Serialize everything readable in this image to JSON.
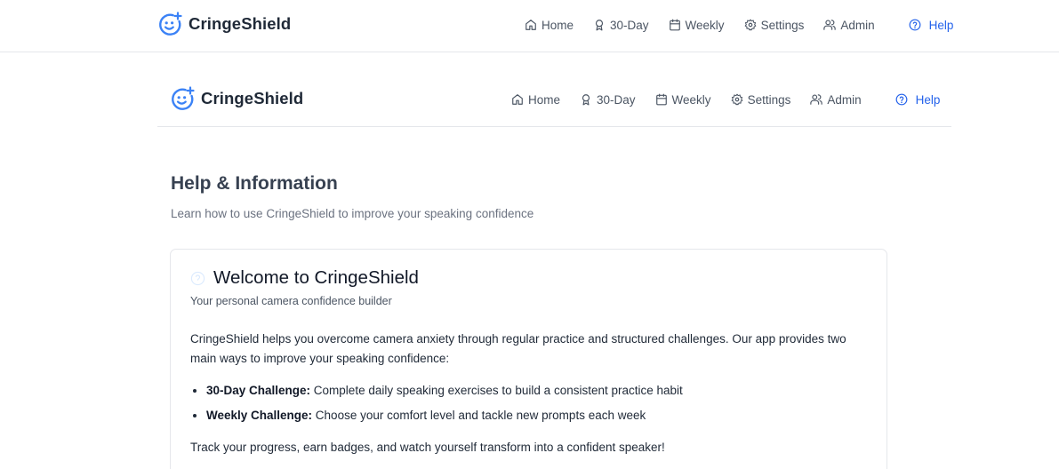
{
  "app": {
    "name": "CringeShield",
    "brand_color": "#3b82f6"
  },
  "nav": {
    "items": [
      {
        "label": "Home",
        "icon": "home-icon"
      },
      {
        "label": "30-Day",
        "icon": "award-icon"
      },
      {
        "label": "Weekly",
        "icon": "calendar-icon"
      },
      {
        "label": "Settings",
        "icon": "gear-icon"
      },
      {
        "label": "Admin",
        "icon": "users-icon"
      }
    ],
    "help": {
      "label": "Help",
      "icon": "help-circle-icon",
      "color": "#2563eb"
    }
  },
  "page": {
    "title": "Help & Information",
    "subtitle": "Learn how to use CringeShield to improve your speaking confidence"
  },
  "welcome_card": {
    "title": "Welcome to CringeShield",
    "subtitle": "Your personal camera confidence builder",
    "intro": "CringeShield helps you overcome camera anxiety through regular practice and structured challenges. Our app provides two main ways to improve your speaking confidence:",
    "features": [
      {
        "name": "30-Day Challenge:",
        "text": " Complete daily speaking exercises to build a consistent practice habit"
      },
      {
        "name": "Weekly Challenge:",
        "text": " Choose your comfort level and tackle new prompts each week"
      }
    ],
    "closing": "Track your progress, earn badges, and watch yourself transform into a confident speaker!"
  }
}
